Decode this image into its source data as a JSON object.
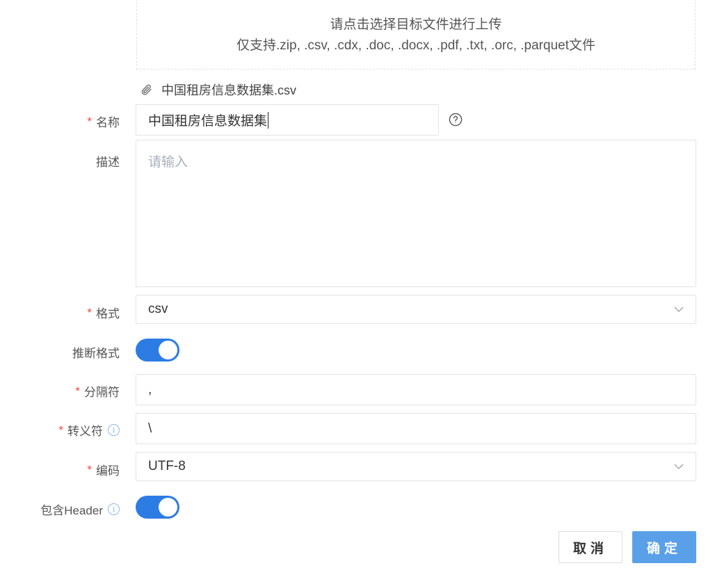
{
  "upload": {
    "prompt": "请点击选择目标文件进行上传",
    "supported": "仅支持.zip, .csv, .cdx, .doc, .docx, .pdf, .txt, .orc, .parquet文件"
  },
  "file": {
    "name": "中国租房信息数据集.csv",
    "icon": "paperclip-icon"
  },
  "form": {
    "name": {
      "required_mark": "*",
      "label": "名称",
      "value": "中国租房信息数据集",
      "help_icon": "question-circle-icon"
    },
    "description": {
      "label": "描述",
      "placeholder": "请输入",
      "value": ""
    },
    "format": {
      "required_mark": "*",
      "label": "格式",
      "value": "csv"
    },
    "infer_format": {
      "label": "推断格式",
      "on": true
    },
    "delimiter": {
      "required_mark": "*",
      "label": "分隔符",
      "value": ","
    },
    "escape": {
      "required_mark": "*",
      "label": "转义符",
      "info": "i",
      "value": "\\"
    },
    "encoding": {
      "required_mark": "*",
      "label": "编码",
      "value": "UTF-8"
    },
    "include_header": {
      "label": "包含Header",
      "info": "i",
      "on": true
    }
  },
  "actions": {
    "cancel_label": "取消",
    "ok_label": "确定"
  },
  "colors": {
    "primary": "#2c7ce4",
    "primary_button": "#5aa0e8",
    "required": "#f5483b",
    "info": "#8cb9ea"
  }
}
